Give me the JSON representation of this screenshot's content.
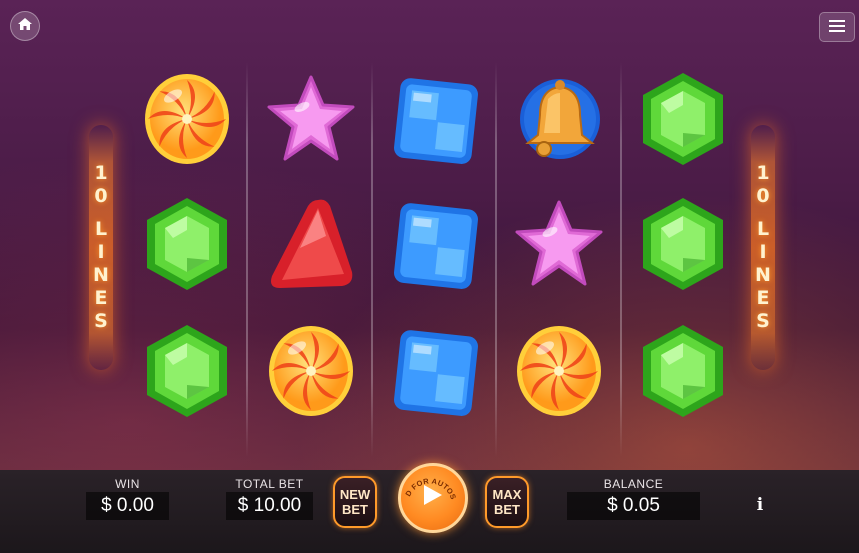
{
  "nav": {
    "home_icon": "home-icon",
    "menu_icon": "hamburger-menu-icon"
  },
  "lines_banner": {
    "left": [
      "1",
      "0",
      "",
      "L",
      "I",
      "N",
      "E",
      "S"
    ],
    "right": [
      "1",
      "0",
      "",
      "L",
      "I",
      "N",
      "E",
      "S"
    ]
  },
  "reels": [
    [
      "swirl-candy",
      "green-gem",
      "green-gem"
    ],
    [
      "pink-star",
      "red-triangle-gem",
      "swirl-candy"
    ],
    [
      "blue-square-gem",
      "blue-square-gem",
      "blue-square-gem"
    ],
    [
      "bell",
      "pink-star",
      "swirl-candy"
    ],
    [
      "green-gem",
      "green-gem",
      "green-gem"
    ]
  ],
  "colors": {
    "accent": "#ff9a2a",
    "bar_bg": "#1c171b"
  },
  "bottom": {
    "win_label": "WIN",
    "win_value": "$ 0.00",
    "total_bet_label": "TOTAL BET",
    "total_bet_value": "$ 10.00",
    "new_bet_line1": "NEW",
    "new_bet_line2": "BET",
    "spin_hint": "HOLD FOR AUTOSPIN",
    "max_bet_line1": "MAX",
    "max_bet_line2": "BET",
    "balance_label": "BALANCE",
    "balance_value": "$ 0.05",
    "info_label": "i"
  }
}
